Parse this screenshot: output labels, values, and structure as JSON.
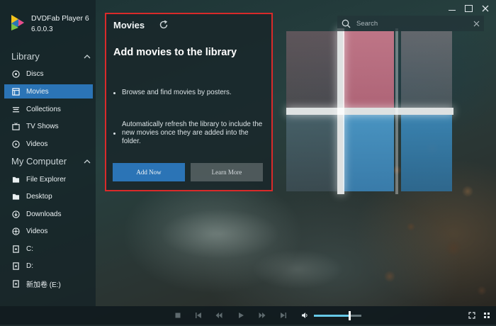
{
  "app": {
    "name": "DVDFab Player 6",
    "version": "6.0.0.3"
  },
  "window_controls": {
    "minimize_icon": "minimize-icon",
    "maximize_icon": "maximize-icon",
    "close_icon": "close-icon"
  },
  "sidebar": {
    "library": {
      "label": "Library",
      "items": [
        {
          "label": "Discs",
          "icon": "disc-icon",
          "active": false
        },
        {
          "label": "Movies",
          "icon": "movie-icon",
          "active": true
        },
        {
          "label": "Collections",
          "icon": "collections-icon",
          "active": false
        },
        {
          "label": "TV Shows",
          "icon": "tv-icon",
          "active": false
        },
        {
          "label": "Videos",
          "icon": "video-icon",
          "active": false
        }
      ]
    },
    "computer": {
      "label": "My Computer",
      "items": [
        {
          "label": "File Explorer",
          "icon": "folder-icon"
        },
        {
          "label": "Desktop",
          "icon": "desktop-folder-icon"
        },
        {
          "label": "Downloads",
          "icon": "download-icon"
        },
        {
          "label": "Videos",
          "icon": "video-icon"
        },
        {
          "label": "C:",
          "icon": "drive-icon"
        },
        {
          "label": "D:",
          "icon": "drive-icon"
        },
        {
          "label": "新加卷 (E:)",
          "icon": "drive-icon"
        }
      ]
    }
  },
  "search": {
    "placeholder": "Search",
    "value": ""
  },
  "panel": {
    "title": "Movies",
    "heading": "Add movies to the library",
    "bullets": [
      "Browse and find movies by posters.",
      "Automatically refresh the library to include the new movies once they are added into the folder."
    ],
    "add_button": "Add Now",
    "learn_button": "Learn More"
  },
  "player": {
    "volume_level": 0.75
  },
  "colors": {
    "accent": "#2b74b6",
    "highlight_border": "#d92a2a",
    "volume": "#67c9e8"
  }
}
